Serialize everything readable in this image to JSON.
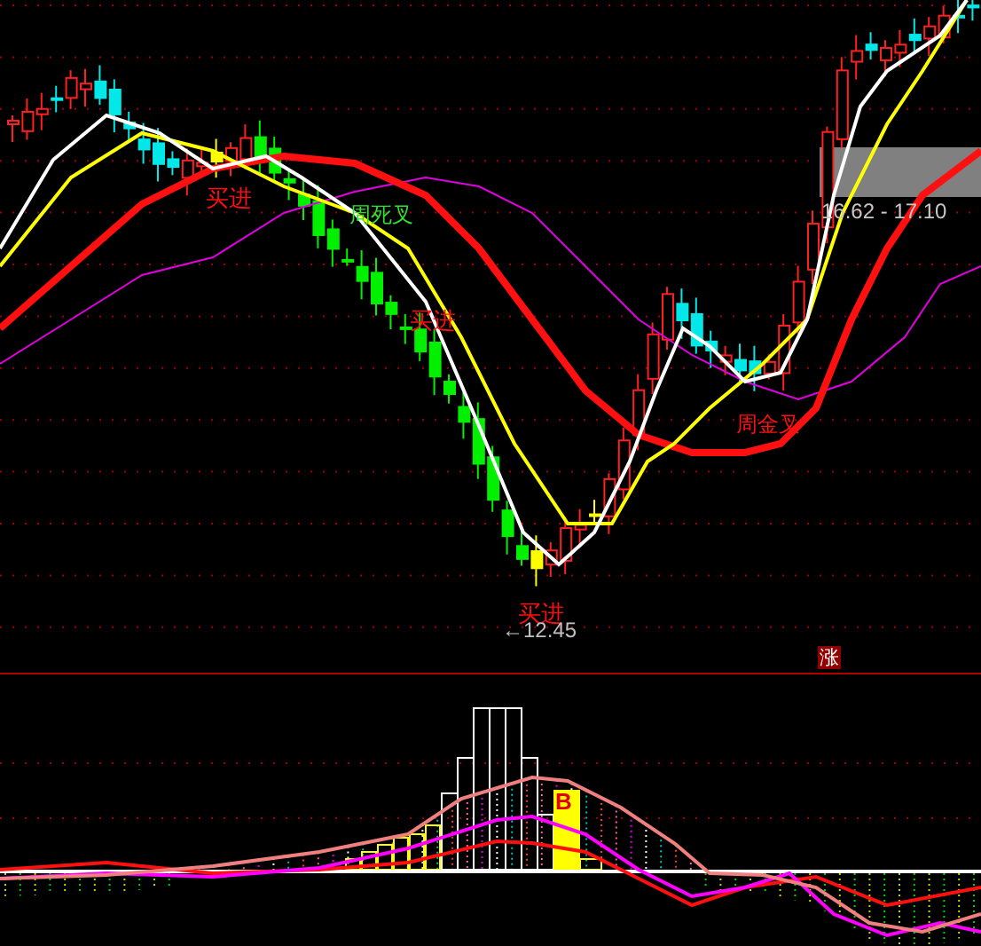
{
  "price_chart": {
    "annotations": [
      {
        "kind": "buy",
        "text": "买进"
      },
      {
        "kind": "dead_cross",
        "text": "周死叉"
      },
      {
        "kind": "buy",
        "text": "买进"
      },
      {
        "kind": "golden_cross",
        "text": "周金叉"
      },
      {
        "kind": "buy",
        "text": "买进"
      },
      {
        "kind": "low_price",
        "text": "←12.45"
      },
      {
        "kind": "price_range",
        "text": "16.62 - 17.10"
      }
    ]
  },
  "rise_badge": {
    "text": "涨"
  },
  "indicator": {
    "signal": {
      "text": "B"
    }
  }
}
